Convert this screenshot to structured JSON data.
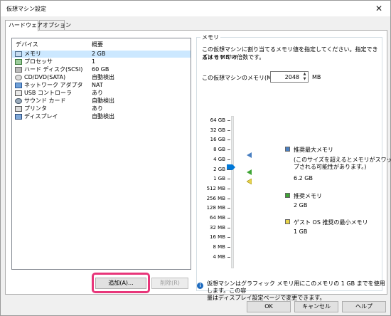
{
  "window": {
    "title": "仮想マシン設定",
    "close_glyph": "✕"
  },
  "tabs": [
    {
      "label": "ハードウェア",
      "active": true
    },
    {
      "label": "オプション",
      "active": false
    }
  ],
  "device_list": {
    "col_device": "デバイス",
    "col_summary": "概要",
    "rows": [
      {
        "name": "メモリ",
        "summary": "2 GB",
        "icon": "memory-icon",
        "selected": true
      },
      {
        "name": "プロセッサ",
        "summary": "1",
        "icon": "processor-icon"
      },
      {
        "name": "ハード ディスク(SCSI)",
        "summary": "60 GB",
        "icon": "hard-disk-icon"
      },
      {
        "name": "CD/DVD(SATA)",
        "summary": "自動検出",
        "icon": "cd-dvd-icon"
      },
      {
        "name": "ネットワーク アダプタ",
        "summary": "NAT",
        "icon": "network-adapter-icon"
      },
      {
        "name": "USB コントローラ",
        "summary": "あり",
        "icon": "usb-controller-icon"
      },
      {
        "name": "サウンド カード",
        "summary": "自動検出",
        "icon": "sound-card-icon"
      },
      {
        "name": "プリンタ",
        "summary": "あり",
        "icon": "printer-icon"
      },
      {
        "name": "ディスプレイ",
        "summary": "自動検出",
        "icon": "display-icon"
      }
    ],
    "add_button": "追加(A)...",
    "remove_button": "削除(R)"
  },
  "memory": {
    "group_label": "メモリ",
    "description_line1": "この仮想マシンに割り当てるメモリ値を指定してください。指定できるメモリ サイ",
    "description_line2": "ズは 4 MB の倍数です。",
    "field_label": "この仮想マシンのメモリ(M):",
    "value": "2048",
    "unit": "MB",
    "scale": [
      "64 GB",
      "32 GB",
      "16 GB",
      "8 GB",
      "4 GB",
      "2 GB",
      "1 GB",
      "512 MB",
      "256 MB",
      "128 MB",
      "64 MB",
      "32 MB",
      "16 MB",
      "8 MB",
      "4 MB"
    ],
    "current_level": "2 GB",
    "max_recommended": {
      "title": "推奨最大メモリ",
      "note_line1": "(このサイズを超えるとメモリがスワッ",
      "note_line2": "プされる可能性があります。)",
      "value": "6.2 GB",
      "color": "#4a7fc1",
      "level": "8 GB"
    },
    "recommended": {
      "title": "推奨メモリ",
      "value": "2 GB",
      "color": "#3fa535",
      "level": "2 GB"
    },
    "guest_min": {
      "title": "ゲスト OS 推奨の最小メモリ",
      "value": "1 GB",
      "color": "#e8d44a",
      "level": "1 GB"
    },
    "info_line1": "仮想マシンはグラフィック メモリ用にこのメモリの 1 GB までを使用します。この容",
    "info_line2": "量はディスプレイ設定ページで変更できます。"
  },
  "footer": {
    "ok": "OK",
    "cancel": "キャンセル",
    "help": "ヘルプ"
  },
  "colors": {
    "accent": "#0078d7",
    "selection": "#cce8ff",
    "highlight": "#e8367a"
  }
}
